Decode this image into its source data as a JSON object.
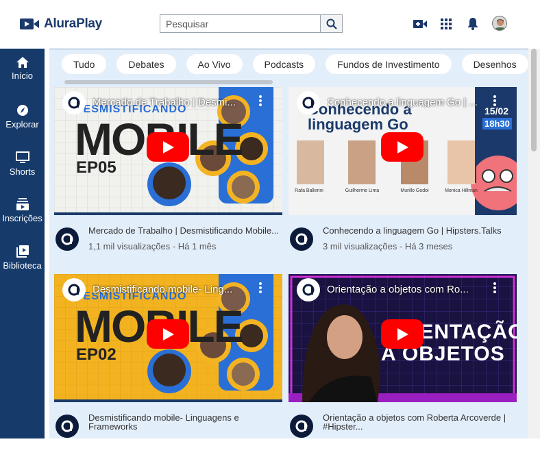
{
  "header": {
    "logo_text": "AluraPlay",
    "search_placeholder": "Pesquisar"
  },
  "sidebar": {
    "items": [
      {
        "label": "Início",
        "icon": "home-icon"
      },
      {
        "label": "Explorar",
        "icon": "compass-icon"
      },
      {
        "label": "Shorts",
        "icon": "shorts-icon"
      },
      {
        "label": "Inscrições",
        "icon": "subscriptions-icon"
      },
      {
        "label": "Biblioteca",
        "icon": "library-icon"
      }
    ]
  },
  "chips": [
    "Tudo",
    "Debates",
    "Ao Vivo",
    "Podcasts",
    "Fundos de Investimento",
    "Desenhos"
  ],
  "videos": [
    {
      "thumb_title": "Mercado de Trabalho | Desmi...",
      "title": "Mercado de Trabalho | Desmistificando Mobile...",
      "info": "1,1 mil visualizações - Há 1 mês",
      "thumb_text1": "DESMISTIFICANDO",
      "thumb_text2": "MOBILE",
      "thumb_text3": "EP05"
    },
    {
      "thumb_title": "Conhecendo a linguagem Go | ...",
      "title": "Conhecendo a linguagem Go | Hipsters.Talks",
      "info": "3 mil visualizações - Há 3 meses",
      "thumb_text1": "Conhecendo a",
      "thumb_text2": "linguagem Go",
      "date": "15/02",
      "time": "18h30",
      "names": [
        "Rafa Ballerini",
        "Guilherme Lima",
        "Murillo Godoi",
        "Monica Hillman"
      ]
    },
    {
      "thumb_title": "Desmistificando mobile- Ling...",
      "title": "Desmistificando mobile- Linguagens e Frameworks",
      "info": "",
      "thumb_text1": "DESMISTIFICANDO",
      "thumb_text2": "MOBILE",
      "thumb_text3": "EP02"
    },
    {
      "thumb_title": "Orientação a objetos com Ro...",
      "title": "Orientação a objetos com Roberta Arcoverde | #Hipster...",
      "info": "",
      "thumb_text1": "ORIENTAÇÃO",
      "thumb_text2": "A OBJETOS"
    }
  ]
}
